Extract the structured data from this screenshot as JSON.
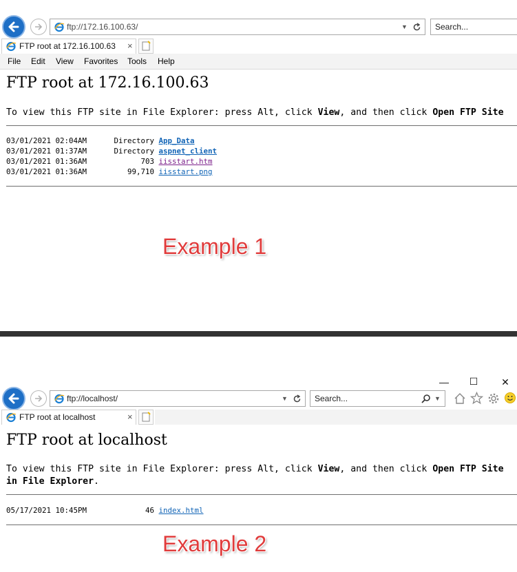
{
  "example1": {
    "address": "ftp://172.16.100.63/",
    "search_placeholder": "Search...",
    "tab_title": "FTP root at 172.16.100.63",
    "tab_close": "×",
    "menu": [
      "File",
      "Edit",
      "View",
      "Favorites",
      "Tools",
      "Help"
    ],
    "page_title": "FTP root at 172.16.100.63",
    "instruction": {
      "prefix": "To view this FTP site in File Explorer: press Alt, click ",
      "view": "View",
      "middle": ", and then click ",
      "open": "Open FTP Site"
    },
    "rows": [
      {
        "date": "03/01/2021 02:04AM",
        "size": "Directory",
        "name": "App_Data"
      },
      {
        "date": "03/01/2021 01:37AM",
        "size": "Directory",
        "name": "aspnet_client"
      },
      {
        "date": "03/01/2021 01:36AM",
        "size": "703",
        "name": "iisstart.htm"
      },
      {
        "date": "03/01/2021 01:36AM",
        "size": "99,710",
        "name": "iisstart.png"
      }
    ],
    "label": "Example 1"
  },
  "example2": {
    "address": "ftp://localhost/",
    "search_placeholder": "Search...",
    "tab_title": "FTP root at localhost",
    "tab_close": "×",
    "window_controls": {
      "minimize": "—",
      "maximize": "☐",
      "close": "✕"
    },
    "page_title": "FTP root at localhost",
    "instruction": {
      "prefix": "To view this FTP site in File Explorer: press Alt, click ",
      "view": "View",
      "middle": ", and then click ",
      "open": "Open FTP Site",
      "line2_bold": "in File Explorer",
      "line2_end": "."
    },
    "rows": [
      {
        "date": "05/17/2021 10:45PM",
        "size": "46",
        "name": "index.html"
      }
    ],
    "label": "Example 2"
  },
  "colors": {
    "link": "#1164b6",
    "visited_link": "#7b1f8a",
    "label": "#e03c3c",
    "back_button": "#1e6fc6",
    "divider": "#333333"
  },
  "icons": [
    "back-arrow-icon",
    "forward-arrow-icon",
    "ie-logo-icon",
    "dropdown-icon",
    "refresh-icon",
    "search-icon",
    "new-tab-icon",
    "home-icon",
    "star-icon",
    "gear-icon",
    "smiley-icon"
  ]
}
